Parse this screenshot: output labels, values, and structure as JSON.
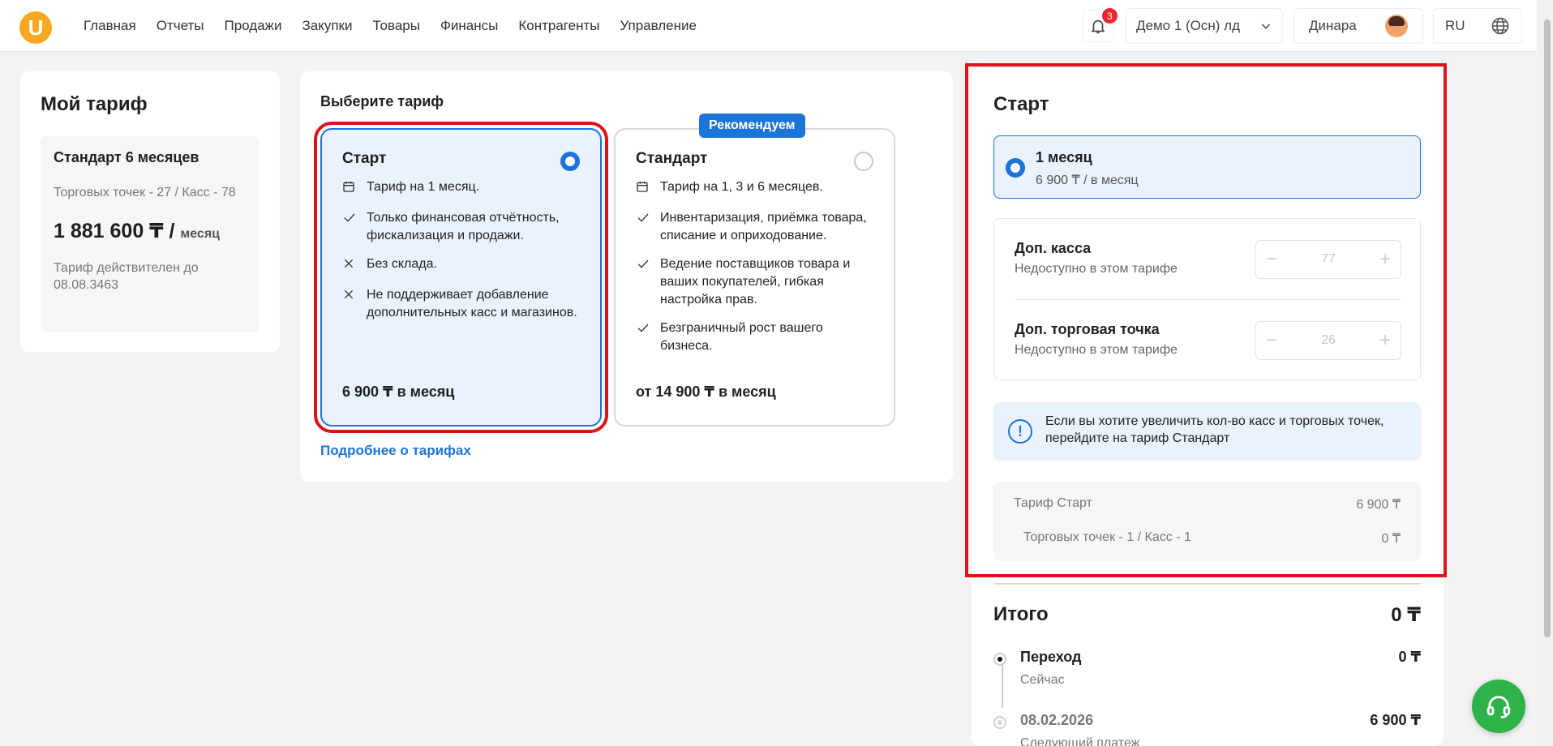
{
  "header": {
    "logo_letter": "U",
    "nav": [
      "Главная",
      "Отчеты",
      "Продажи",
      "Закупки",
      "Товары",
      "Финансы",
      "Контрагенты",
      "Управление"
    ],
    "notifications_count": "3",
    "company": "Демо 1 (Осн) лд",
    "user": "Динара",
    "lang": "RU"
  },
  "my_tariff": {
    "title": "Мой тариф",
    "name": "Стандарт 6 месяцев",
    "points": "Торговых точек - 27 / Касс - 78",
    "price": "1 881 600 ₸ /",
    "price_unit": "месяц",
    "valid": "Тариф действителен до 08.08.3463"
  },
  "choose": {
    "title": "Выберите тариф",
    "recommend_badge": "Рекомендуем",
    "more_link": "Подробнее о тарифах",
    "plans": [
      {
        "name": "Старт",
        "features": [
          {
            "icon": "calendar-icon",
            "text": "Тариф на 1 месяц."
          },
          {
            "icon": "check-icon",
            "text": "Только финансовая отчётность, фискализация и продажи."
          },
          {
            "icon": "cross-icon",
            "text": "Без склада."
          },
          {
            "icon": "cross-icon",
            "text": "Не поддерживает добавление дополнительных касс и магазинов."
          }
        ],
        "price": "6 900 ₸ в месяц",
        "selected": true
      },
      {
        "name": "Стандарт",
        "features": [
          {
            "icon": "calendar-icon",
            "text": "Тариф на 1, 3 и 6 месяцев."
          },
          {
            "icon": "check-icon",
            "text": "Инвентаризация, приёмка товара, списание и оприходование."
          },
          {
            "icon": "check-icon",
            "text": "Ведение поставщиков товара и ваших покупателей, гибкая настройка прав."
          },
          {
            "icon": "check-icon",
            "text": "Безграничный рост вашего бизнеса."
          }
        ],
        "price": "от 14 900 ₸ в месяц",
        "selected": false
      }
    ]
  },
  "right": {
    "title": "Старт",
    "period": {
      "label": "1 месяц",
      "price": "6 900 ₸ / в месяц"
    },
    "addons": [
      {
        "name": "Доп. касса",
        "note": "Недоступно в этом тарифе",
        "value": "77"
      },
      {
        "name": "Доп. торговая точка",
        "note": "Недоступно в этом тарифе",
        "value": "26"
      }
    ],
    "info": "Если вы хотите увеличить кол-во касс и торговых точек, перейдите на тариф Стандарт",
    "summary": [
      {
        "label": "Тариф Старт",
        "value": "6 900 ₸"
      },
      {
        "label": "Торговых точек - 1 / Касс - 1",
        "value": "0 ₸"
      }
    ],
    "total_label": "Итого",
    "total_value": "0 ₸",
    "steps": [
      {
        "title": "Переход",
        "sub": "Сейчас",
        "amount": "0 ₸"
      },
      {
        "title": "08.02.2026",
        "sub": "Следующий платеж",
        "amount": "6 900 ₸"
      }
    ]
  },
  "colors": {
    "accent": "#1b74d8",
    "highlight": "#d9141c",
    "logo": "#f7a823",
    "support": "#2db34a"
  }
}
